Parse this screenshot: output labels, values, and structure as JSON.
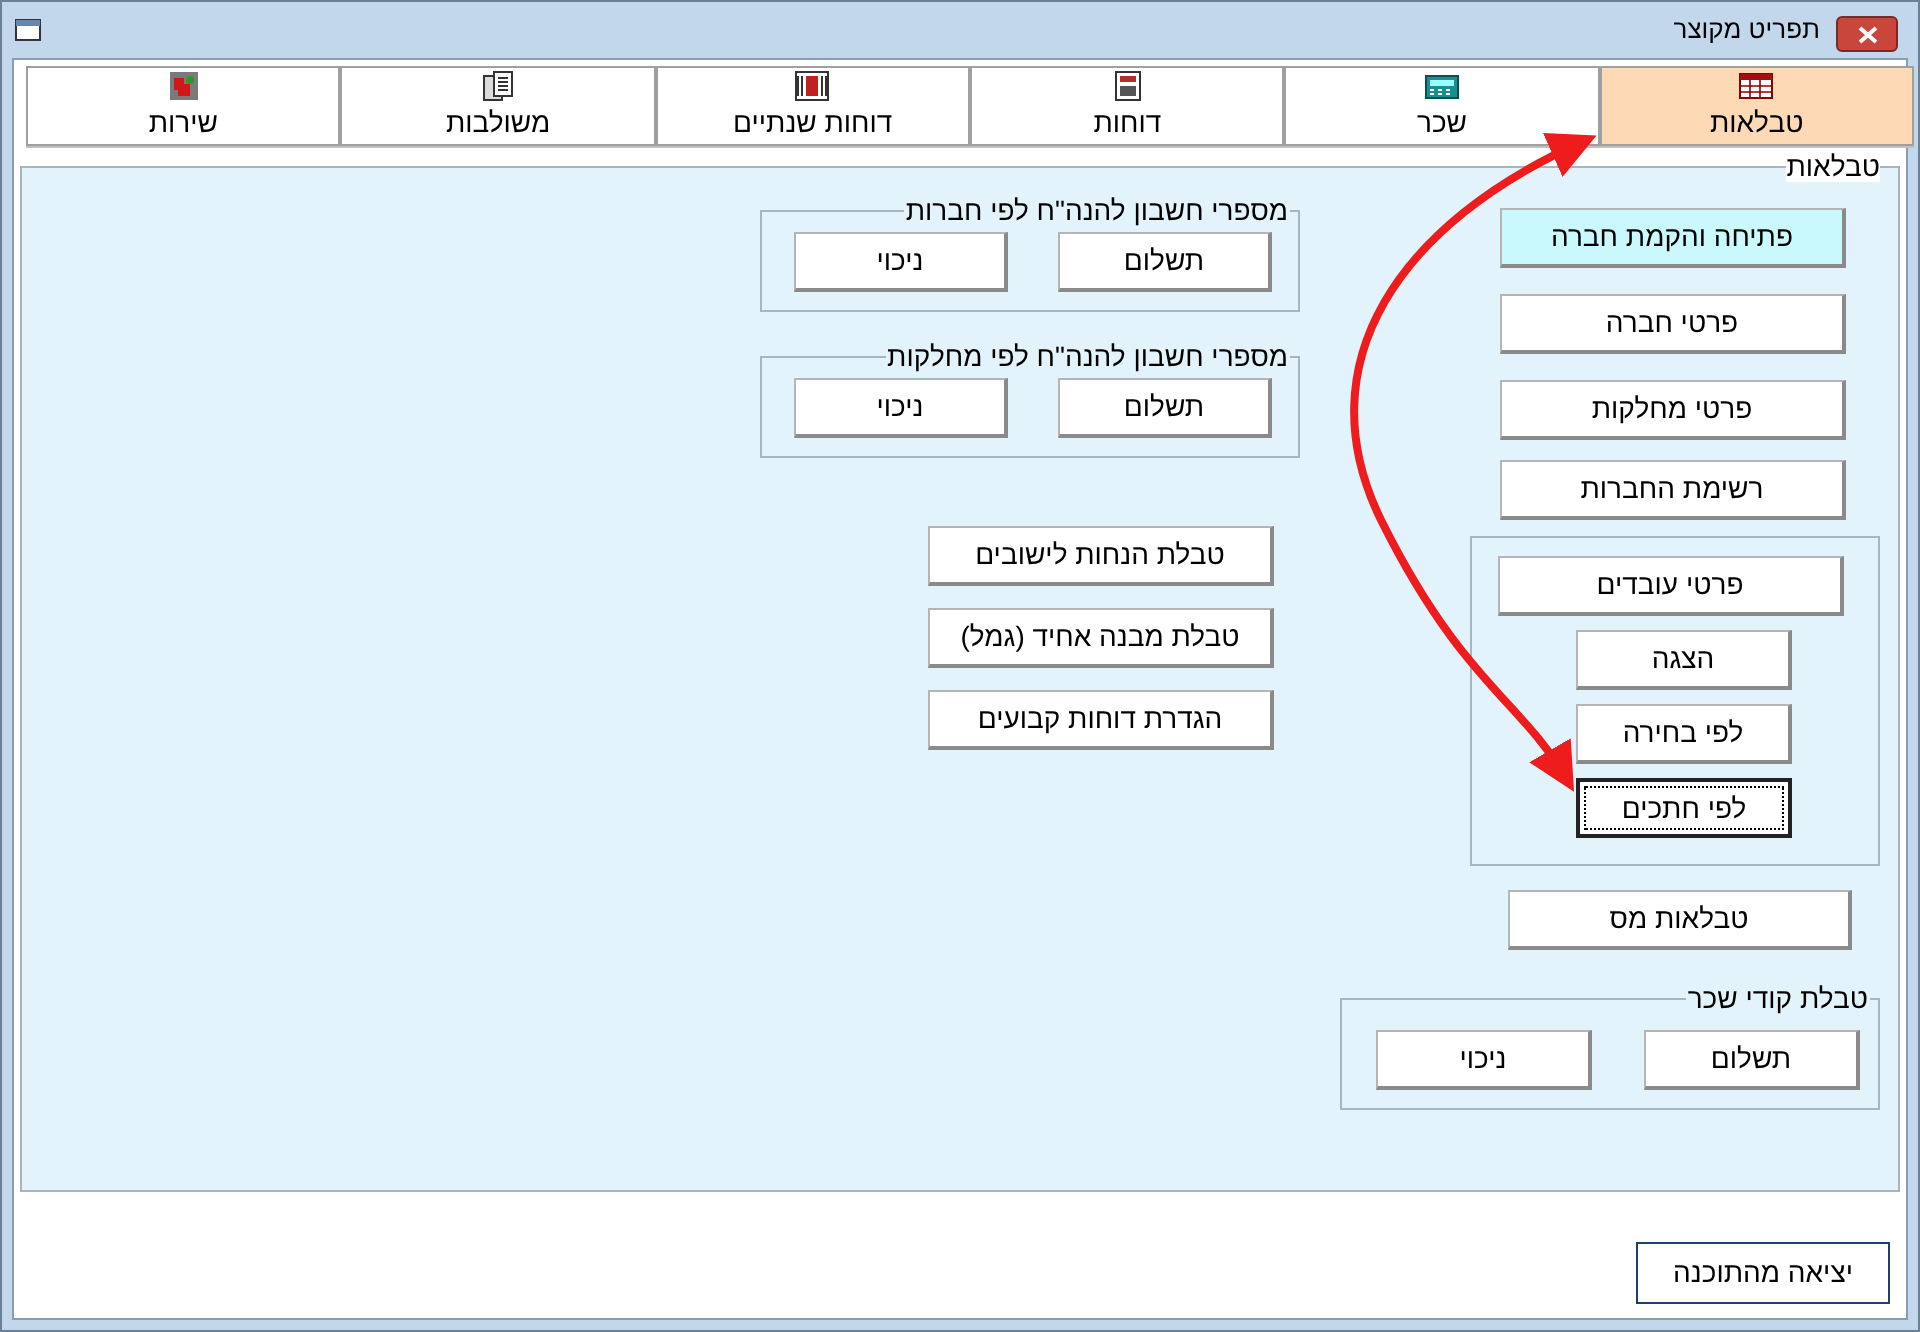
{
  "window": {
    "title": "תפריט מקוצר"
  },
  "tabs": [
    {
      "label": "טבלאות",
      "selected": true
    },
    {
      "label": "שכר",
      "selected": false
    },
    {
      "label": "דוחות",
      "selected": false
    },
    {
      "label": "דוחות שנתיים",
      "selected": false
    },
    {
      "label": "משולבות",
      "selected": false
    },
    {
      "label": "שירות",
      "selected": false
    }
  ],
  "panel": {
    "title": "טבלאות"
  },
  "main_buttons": [
    {
      "label": "פתיחה והקמת חברה",
      "highlighted": true
    },
    {
      "label": "פרטי חברה",
      "highlighted": false
    },
    {
      "label": "פרטי מחלקות",
      "highlighted": false
    },
    {
      "label": "רשימת החברות",
      "highlighted": false
    }
  ],
  "employees_group": {
    "button": "פרטי עובדים",
    "sub_buttons": [
      {
        "label": "הצגה",
        "focused": false
      },
      {
        "label": "לפי בחירה",
        "focused": false
      },
      {
        "label": "לפי חתכים",
        "focused": true
      }
    ]
  },
  "tax_button": "טבלאות מס",
  "wage_codes_group": {
    "title": "טבלת קודי שכר",
    "buttons": [
      "תשלום",
      "ניכוי"
    ]
  },
  "account_groups": [
    {
      "title": "מספרי חשבון להנה\"ח לפי חברות",
      "buttons": [
        "תשלום",
        "ניכוי"
      ]
    },
    {
      "title": "מספרי חשבון להנה\"ח לפי מחלקות",
      "buttons": [
        "תשלום",
        "ניכוי"
      ]
    }
  ],
  "table_buttons": [
    "טבלת הנחות לישובים",
    "טבלת מבנה אחיד (גמל)",
    "הגדרת דוחות קבועים"
  ],
  "exit_button": "יציאה מהתוכנה"
}
